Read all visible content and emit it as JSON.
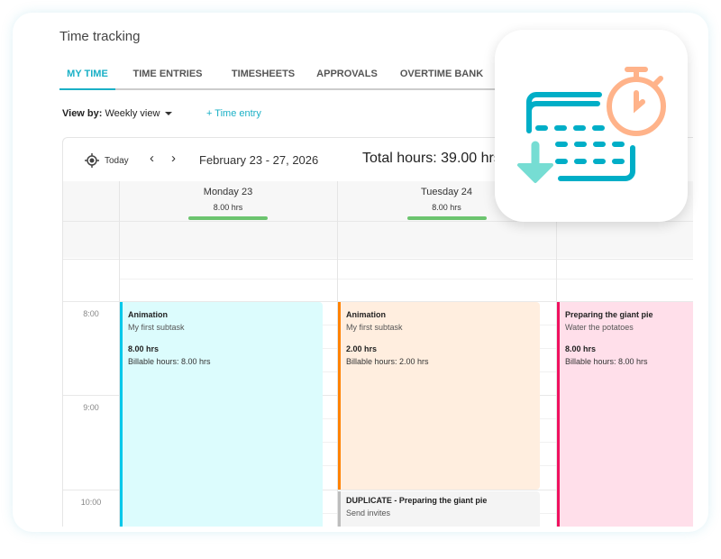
{
  "header": {
    "title": "Time tracking"
  },
  "tabs": [
    {
      "label": "MY TIME",
      "active": true
    },
    {
      "label": "TIME ENTRIES"
    },
    {
      "label": "TIMESHEETS"
    },
    {
      "label": "APPROVALS"
    },
    {
      "label": "OVERTIME BANK"
    }
  ],
  "toolbar": {
    "view_by_label": "View by:",
    "view_value": "Weekly view",
    "add_entry": "+ Time entry"
  },
  "calendar": {
    "today_label": "Today",
    "date_range": "February 23 - 27, 2026",
    "total_hours": "Total hours: 39.00 hrs",
    "days": [
      {
        "name": "Monday 23",
        "hours": "8.00 hrs"
      },
      {
        "name": "Tuesday 24",
        "hours": "8.00 hrs"
      }
    ],
    "times": [
      "8:00",
      "9:00",
      "10:00"
    ],
    "events": [
      {
        "title": "Animation",
        "subtask": "My first subtask",
        "hours": "8.00 hrs",
        "billable": "Billable hours: 8.00 hrs",
        "color": "#00c8ea",
        "bg": "#dcfcfd"
      },
      {
        "title": "Animation",
        "subtask": "My first subtask",
        "hours": "2.00 hrs",
        "billable": "Billable hours: 2.00 hrs",
        "color": "#ff8200",
        "bg": "#ffeedf"
      },
      {
        "title": "DUPLICATE - Preparing the giant pie",
        "subtask": "Send invites",
        "color": "#bdbdbd",
        "bg": "#f4f4f4"
      },
      {
        "title": "Preparing the giant pie",
        "subtask": "Water the potatoes",
        "hours": "8.00 hrs",
        "billable": "Billable hours: 8.00 hrs",
        "color": "#f0115f",
        "bg": "#ffdfea"
      }
    ]
  },
  "colors": {
    "accent": "#1ab0c6",
    "progress": "#6cc46f"
  },
  "app_icon": {
    "name": "timesheet-stopwatch-icon",
    "colors": [
      "#00aec7",
      "#ffb38a",
      "#76ddd3"
    ]
  }
}
